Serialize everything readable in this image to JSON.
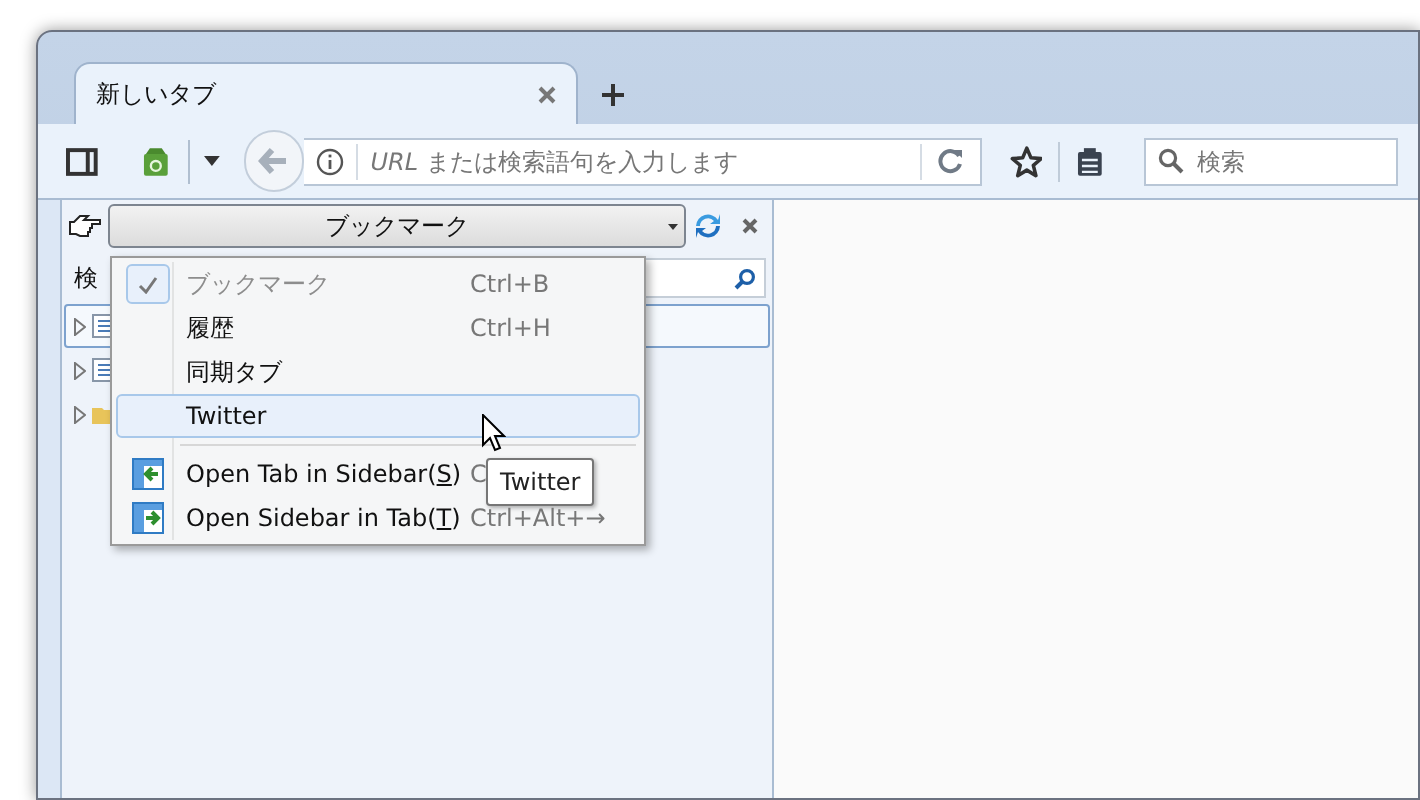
{
  "tabs": [
    {
      "label": "新しいタブ",
      "selected": true
    }
  ],
  "toolbar": {
    "url_placeholder": "*URL* または検索語句を入力します",
    "search_placeholder": "検索"
  },
  "sidebar": {
    "selector": "ブックマーク",
    "search_label": "検",
    "tree_rows": [
      {
        "kind": "list",
        "selected": true
      },
      {
        "kind": "list",
        "selected": false
      },
      {
        "kind": "folder",
        "selected": false
      }
    ]
  },
  "menu": {
    "items": [
      {
        "kind": "item",
        "label_parts": [
          "ブックマーク"
        ],
        "shortcut": "Ctrl+B",
        "checked": true,
        "disabled": true,
        "highlighted": false
      },
      {
        "kind": "item",
        "label_parts": [
          "履歴"
        ],
        "shortcut": "Ctrl+H",
        "checked": false,
        "disabled": false,
        "highlighted": false
      },
      {
        "kind": "item",
        "label_parts": [
          "同期タブ"
        ],
        "checked": false,
        "disabled": false,
        "highlighted": false
      },
      {
        "kind": "item",
        "label_parts": [
          "Twitter"
        ],
        "checked": false,
        "disabled": false,
        "highlighted": true
      },
      {
        "kind": "separator"
      },
      {
        "kind": "icon-item",
        "label_parts": [
          "Open Tab in Sidebar(",
          "S",
          ")"
        ],
        "shortcut": "C",
        "checked": false,
        "disabled": false,
        "highlighted": false
      },
      {
        "kind": "icon-item",
        "label_parts": [
          "Open Sidebar in Tab(",
          "T",
          ")"
        ],
        "shortcut": "Ctrl+Alt+→",
        "checked": false,
        "disabled": false,
        "highlighted": false
      }
    ]
  },
  "tooltip": "Twitter"
}
